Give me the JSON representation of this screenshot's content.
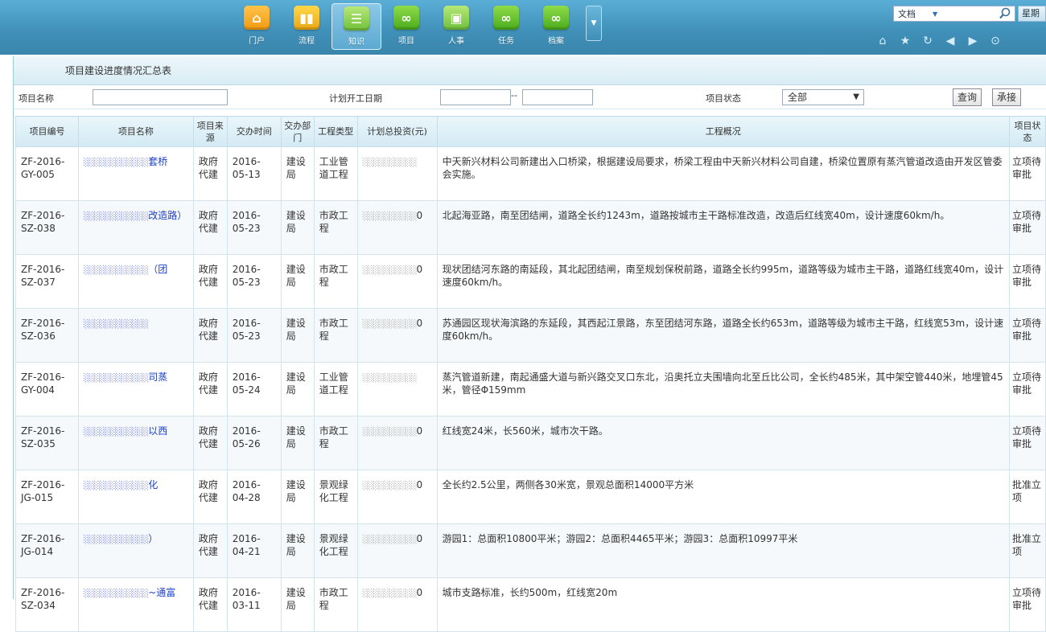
{
  "nav": {
    "items": [
      {
        "label": "门户",
        "icon": "home-icon",
        "glyph": "⌂"
      },
      {
        "label": "流程",
        "icon": "bar-chart-icon",
        "glyph": "▮▮"
      },
      {
        "label": "知识",
        "icon": "list-icon",
        "glyph": "☰"
      },
      {
        "label": "项目",
        "icon": "infinity-icon",
        "glyph": "∞"
      },
      {
        "label": "人事",
        "icon": "window-icon",
        "glyph": "▣"
      },
      {
        "label": "任务",
        "icon": "infinity-icon",
        "glyph": "∞"
      },
      {
        "label": "档案",
        "icon": "infinity-icon",
        "glyph": "∞"
      }
    ],
    "more_glyph": "▼"
  },
  "search": {
    "type": "文档",
    "caret": "▼"
  },
  "weekday": "星期",
  "toolbar": {
    "home": "⌂",
    "star": "★",
    "refresh": "↻",
    "back": "◀",
    "forward": "▶",
    "down": "⊙"
  },
  "page_title": "项目建设进度情况汇总表",
  "filter": {
    "name_label": "项目名称",
    "date_label": "计划开工日期",
    "date_sep": "--",
    "status_label": "项目状态",
    "status_value": "全部",
    "query_button": "查询",
    "submit_button": "承接"
  },
  "table": {
    "headers": [
      "项目编号",
      "项目名称",
      "项目来源",
      "交办时间",
      "交办部门",
      "工程类型",
      "计划总投资(元)",
      "工程概况",
      "项目状态"
    ],
    "rows": [
      {
        "code": "ZF-2016-GY-005",
        "name_tail": "套桥",
        "source": "政府代建",
        "date": "2016-05-13",
        "dept": "建设局",
        "type": "工业管道工程",
        "invest_tail": "",
        "summary": "中天新兴材料公司新建出入口桥梁，根据建设局要求，桥梁工程由中天新兴材料公司自建，桥梁位置原有蒸汽管道改造由开发区管委会实施。",
        "status": "立项待审批"
      },
      {
        "code": "ZF-2016-SZ-038",
        "name_tail": "改造路）",
        "source": "政府代建",
        "date": "2016-05-23",
        "dept": "建设局",
        "type": "市政工程",
        "invest_tail": "0",
        "summary": "北起海亚路，南至团结闸，道路全长约1243m，道路按城市主干路标准改造，改造后红线宽40m，设计速度60km/h。",
        "status": "立项待审批"
      },
      {
        "code": "ZF-2016-SZ-037",
        "name_tail": "（团",
        "source": "政府代建",
        "date": "2016-05-23",
        "dept": "建设局",
        "type": "市政工程",
        "invest_tail": "0",
        "summary": "现状团结河东路的南延段，其北起团结闸，南至规划保税前路，道路全长约995m，道路等级为城市主干路，道路红线宽40m，设计速度60km/h。",
        "status": "立项待审批"
      },
      {
        "code": "ZF-2016-SZ-036",
        "name_tail": "",
        "source": "政府代建",
        "date": "2016-05-23",
        "dept": "建设局",
        "type": "市政工程",
        "invest_tail": "0",
        "summary": "苏通园区现状海滨路的东延段，其西起江景路，东至团结河东路，道路全长约653m，道路等级为城市主干路，红线宽53m，设计速度60km/h。",
        "status": "立项待审批"
      },
      {
        "code": "ZF-2016-GY-004",
        "name_tail": "司蒸",
        "source": "政府代建",
        "date": "2016-05-24",
        "dept": "建设局",
        "type": "工业管道工程",
        "invest_tail": "",
        "summary": "蒸汽管道新建，南起通盛大道与新兴路交叉口东北，沿奥托立夫围墙向北至丘比公司，全长约485米，其中架空管440米，地埋管45米，管径Φ159mm",
        "status": "立项待审批"
      },
      {
        "code": "ZF-2016-SZ-035",
        "name_tail": "以西",
        "source": "政府代建",
        "date": "2016-05-26",
        "dept": "建设局",
        "type": "市政工程",
        "invest_tail": "0",
        "summary": "红线宽24米，长560米，城市次干路。",
        "status": "立项待审批"
      },
      {
        "code": "ZF-2016-JG-015",
        "name_tail": "化",
        "source": "政府代建",
        "date": "2016-04-28",
        "dept": "建设局",
        "type": "景观绿化工程",
        "invest_tail": "0",
        "summary": "全长约2.5公里，两侧各30米宽，景观总面积14000平方米",
        "status": "批准立项"
      },
      {
        "code": "ZF-2016-JG-014",
        "name_tail": "）",
        "source": "政府代建",
        "date": "2016-04-21",
        "dept": "建设局",
        "type": "景观绿化工程",
        "invest_tail": "0",
        "summary": "游园1：总面积10800平米；游园2：总面积4465平米；游园3：总面积10997平米",
        "status": "批准立项"
      },
      {
        "code": "ZF-2016-SZ-034",
        "name_tail": "~通富",
        "source": "政府代建",
        "date": "2016-03-11",
        "dept": "建设局",
        "type": "市政工程",
        "invest_tail": "0",
        "summary": "城市支路标准，长约500m，红线宽20m",
        "status": "立项待审批"
      }
    ]
  }
}
